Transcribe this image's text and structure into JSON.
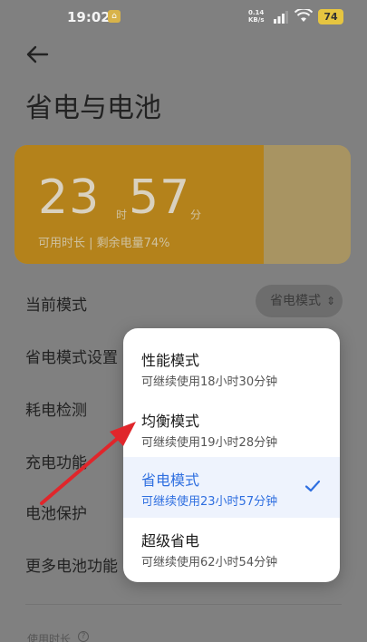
{
  "status_bar": {
    "time": "19:02",
    "net_speed_value": "0.14",
    "net_speed_unit": "KB/s",
    "battery_level": "74"
  },
  "header": {
    "title": "省电与电池"
  },
  "battery_card": {
    "hours": "23",
    "hours_unit": "时",
    "minutes": "57",
    "minutes_unit": "分",
    "subtitle": "可用时长 | 剩余电量74%",
    "charge_fraction": 0.74,
    "fill_color": "#b4821b"
  },
  "settings": {
    "current_mode_label": "当前模式",
    "current_mode_value": "省电模式",
    "items": [
      {
        "label": "省电模式设置"
      },
      {
        "label": "耗电检测"
      },
      {
        "label": "充电功能"
      },
      {
        "label": "电池保护"
      },
      {
        "label": "更多电池功能"
      }
    ],
    "usage_label": "使用时长"
  },
  "mode_popup": {
    "options": [
      {
        "title": "性能模式",
        "subtitle": "可继续使用18小时30分钟",
        "selected": false
      },
      {
        "title": "均衡模式",
        "subtitle": "可继续使用19小时28分钟",
        "selected": false
      },
      {
        "title": "省电模式",
        "subtitle": "可继续使用23小时57分钟",
        "selected": true
      },
      {
        "title": "超级省电",
        "subtitle": "可继续使用62小时54分钟",
        "selected": false
      }
    ],
    "accent_color": "#2f6fe0"
  },
  "annotation": {
    "arrow_color": "#e0262b"
  }
}
